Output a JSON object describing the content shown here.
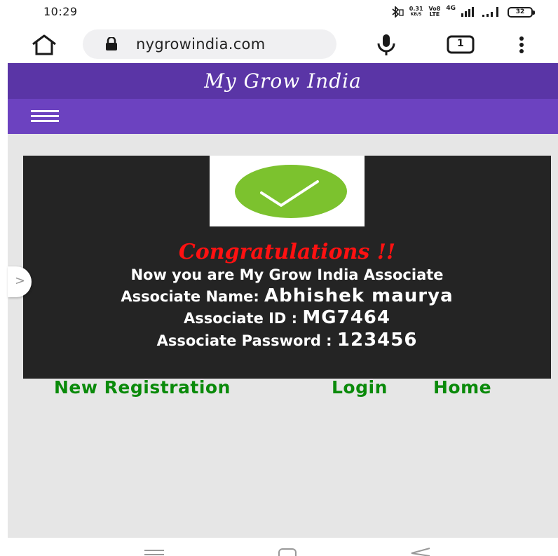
{
  "status_bar": {
    "time": "10:29",
    "net_speed_value": "0.31",
    "net_speed_unit": "KB/S",
    "volte_top": "Vo8",
    "volte_bottom": "LTE",
    "network_type": "4G",
    "battery": "32"
  },
  "browser": {
    "url": "nygrowindia.com",
    "tab_count": "1"
  },
  "site": {
    "title": "My Grow India"
  },
  "result": {
    "heading": "Congratulations !!",
    "line1": "Now you are My Grow India Associate",
    "name_label": "Associate Name: ",
    "name_value": "Abhishek maurya",
    "id_label": "Associate ID : ",
    "id_value": "MG7464",
    "password_label": "Associate Password : ",
    "password_value": "123456"
  },
  "side_tab": {
    "glyph": ">"
  },
  "links": {
    "new_registration": "New Registration",
    "login": "Login",
    "home": "Home"
  },
  "colors": {
    "header_bg": "#5a35a6",
    "nav_bg": "#6c42c0",
    "panel_bg": "#242424",
    "congrats": "#ff1111",
    "link": "#0a8a0a",
    "check_green": "#7cc22e"
  }
}
